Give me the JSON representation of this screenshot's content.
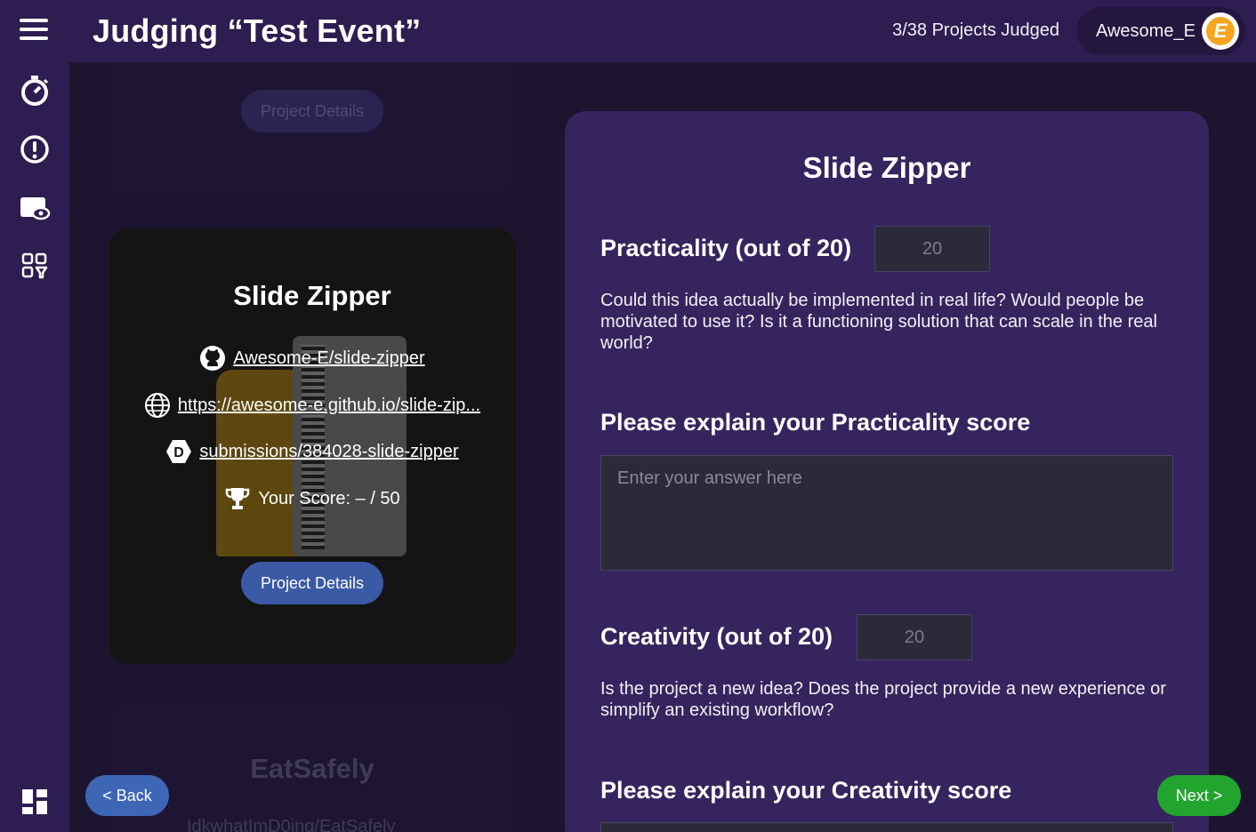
{
  "header": {
    "title": "Judging “Test Event”",
    "progress": "3/38 Projects Judged",
    "user_name": "Awesome_E",
    "avatar_letter": "E"
  },
  "sidebar": {
    "icons": [
      "menu-icon",
      "stopwatch-icon",
      "alert-icon",
      "monitor-eye-icon",
      "apps-filter-icon",
      "dashboard-icon"
    ]
  },
  "project_list": {
    "previous_card": {
      "details_label": "Project Details"
    },
    "current_card": {
      "title": "Slide Zipper",
      "github": "Awesome-E/slide-zipper",
      "website": "https://awesome-e.github.io/slide-zip...",
      "devpost": "submissions/384028-slide-zipper",
      "score": "Your Score: – / 50",
      "details_label": "Project Details"
    },
    "next_card": {
      "title": "EatSafely",
      "github": "IdkwhatImD0ing/EatSafely"
    }
  },
  "judging": {
    "project_title": "Slide Zipper",
    "criteria": [
      {
        "label": "Practicality (out of 20)",
        "score_placeholder": "20",
        "description": "Could this idea actually be implemented in real life? Would people be motivated to use it? Is it a functioning solution that can scale in the real world?",
        "explain_label": "Please explain your Practicality score",
        "answer_placeholder": "Enter your answer here"
      },
      {
        "label": "Creativity (out of 20)",
        "score_placeholder": "20",
        "description": "Is the project a new idea? Does the project provide a new experience or simplify an existing workflow?",
        "explain_label": "Please explain your Creativity score"
      }
    ]
  },
  "nav": {
    "back_label": "< Back",
    "next_label": "Next >"
  },
  "colors": {
    "header_bg": "#2e1d50",
    "panel_bg": "#35245d",
    "accent_blue": "#3d66b5",
    "accent_green": "#22a52e"
  }
}
